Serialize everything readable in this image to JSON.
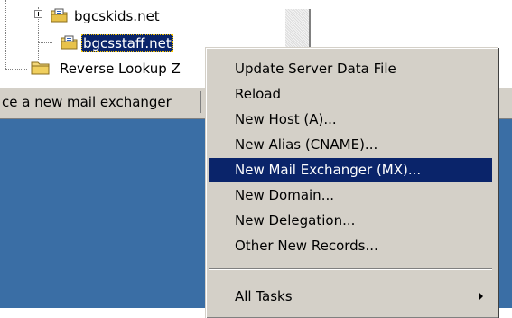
{
  "tree": {
    "items": [
      {
        "label": "bgcskids.net",
        "expandable": true,
        "selected": false
      },
      {
        "label": "bgcsstaff.net",
        "expandable": false,
        "selected": true
      },
      {
        "label": "Reverse Lookup Z",
        "expandable": false,
        "selected": false
      }
    ]
  },
  "status_bar": {
    "text": "ce a new mail exchanger"
  },
  "context_menu": {
    "items": [
      {
        "label": "Update Server Data File",
        "accelerator": "U",
        "highlighted": false
      },
      {
        "label": "Reload",
        "accelerator": "e",
        "highlighted": false
      },
      {
        "label": "New Host (A)...",
        "accelerator": "s",
        "highlighted": false
      },
      {
        "label": "New Alias (CNAME)...",
        "accelerator": "A",
        "highlighted": false
      },
      {
        "label": "New Mail Exchanger (MX)...",
        "accelerator": "M",
        "highlighted": true
      },
      {
        "label": "New Domain...",
        "accelerator": "o",
        "highlighted": false
      },
      {
        "label": "New Delegation...",
        "accelerator": "l",
        "highlighted": false
      },
      {
        "label": "Other New Records...",
        "accelerator": "c",
        "highlighted": false
      },
      {
        "label": "All Tasks",
        "accelerator": "k",
        "highlighted": false,
        "submenu": true
      }
    ]
  },
  "colors": {
    "selection": "#0a246a",
    "menu_face": "#d4d0c8",
    "desktop_blue": "#3a6ea5",
    "focus_outline": "#f0c000"
  },
  "icons": {
    "expander": "plus-box-icon",
    "zone": "zone-folder-icon",
    "folder": "folder-icon",
    "submenu": "submenu-arrow-icon"
  }
}
